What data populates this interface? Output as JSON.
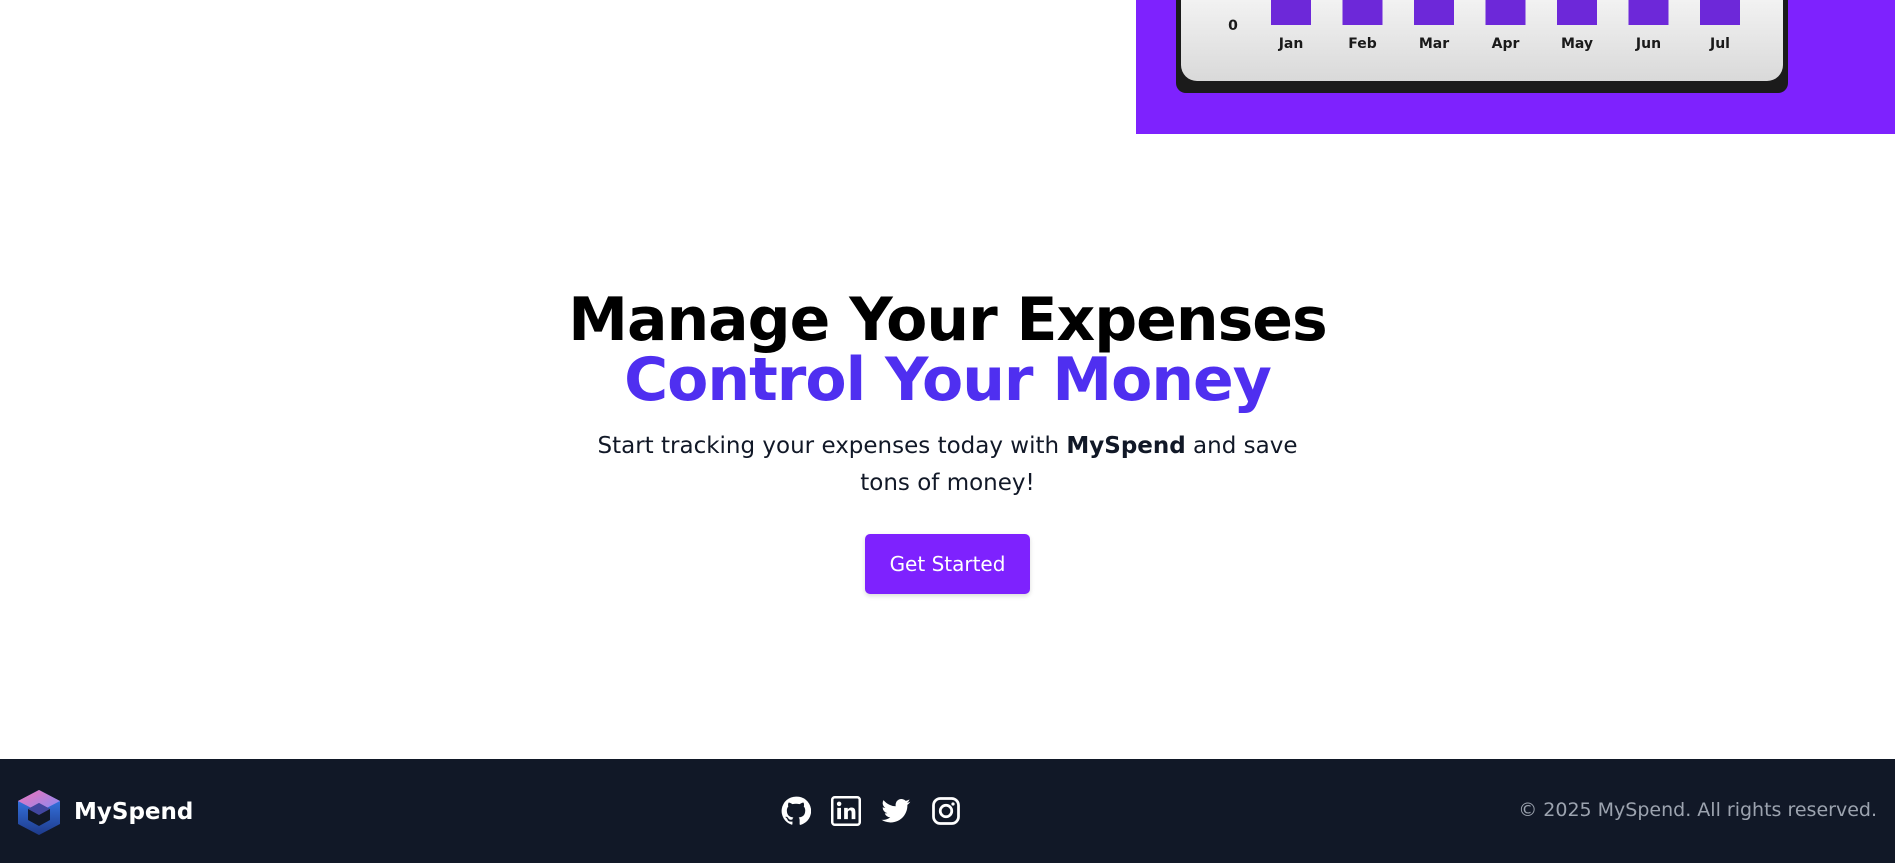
{
  "chart_data": {
    "type": "bar",
    "categories": [
      "Jan",
      "Feb",
      "Mar",
      "Apr",
      "May",
      "Jun",
      "Jul"
    ],
    "y_tick_label": "0",
    "bar_color": "#6d28d9"
  },
  "hero": {
    "title": "Manage Your Expenses",
    "subtitle": "Control Your Money",
    "desc_before": "Start tracking your expenses today with ",
    "desc_brand": "MySpend",
    "desc_after": " and save tons of money!",
    "cta_label": "Get Started"
  },
  "footer": {
    "brand_name": "MySpend",
    "logo_icon": "hexagon-cube-logo",
    "social_icons": [
      "github-icon",
      "linkedin-icon",
      "twitter-icon",
      "instagram-icon"
    ],
    "copyright": "© 2025 MySpend. All rights reserved."
  },
  "colors": {
    "accent": "#7e22fe",
    "heading_accent": "#4f2ff0",
    "footer_bg": "#111827"
  }
}
